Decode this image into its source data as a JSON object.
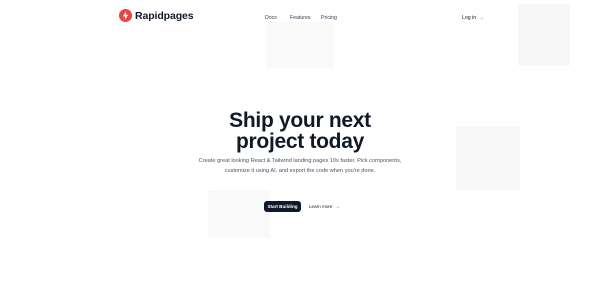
{
  "header": {
    "brand_name": "Rapidpages",
    "logo_icon": "bolt-icon",
    "nav": [
      {
        "label": "Docs"
      },
      {
        "label": "Features"
      },
      {
        "label": "Pricing"
      }
    ],
    "login_label": "Log in",
    "login_arrow": "→"
  },
  "hero": {
    "title_line1": "Ship your next",
    "title_line2": "project today",
    "subtitle_line1": "Create great looking React & Tailwind landing pages 10x faster. Pick components,",
    "subtitle_line2": "customize it using AI, and export the code when you're done.",
    "primary_cta": "Start Building",
    "secondary_cta": "Learn more",
    "secondary_arrow": "→"
  },
  "colors": {
    "brand_red": "#e4483f",
    "text_dark": "#111827",
    "button_bg": "#111827"
  }
}
